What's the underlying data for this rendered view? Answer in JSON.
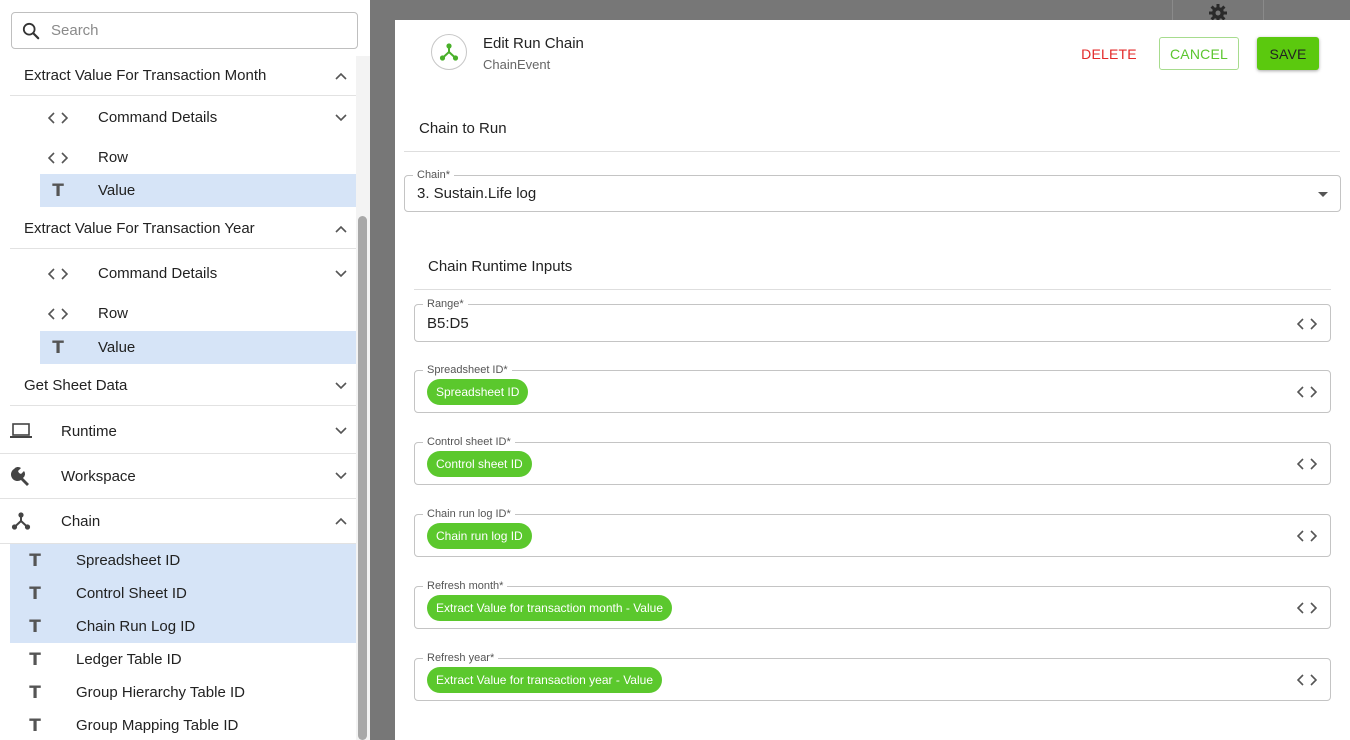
{
  "search": {
    "placeholder": "Search"
  },
  "sidebar": {
    "groups": [
      {
        "title": "Extract Value For Transaction Month",
        "items": [
          {
            "label": "Command Details"
          },
          {
            "label": "Row"
          },
          {
            "label": "Value"
          }
        ]
      },
      {
        "title": "Extract Value For Transaction Year",
        "items": [
          {
            "label": "Command Details"
          },
          {
            "label": "Row"
          },
          {
            "label": "Value"
          }
        ]
      },
      {
        "title": "Get Sheet Data",
        "items": []
      }
    ],
    "categories": [
      {
        "label": "Runtime",
        "icon": "laptop-icon"
      },
      {
        "label": "Workspace",
        "icon": "wrench-icon"
      },
      {
        "label": "Chain",
        "icon": "chain-icon"
      }
    ],
    "chain_items": [
      {
        "label": "Spreadsheet ID"
      },
      {
        "label": "Control Sheet ID"
      },
      {
        "label": "Chain Run Log ID"
      },
      {
        "label": "Ledger Table ID"
      },
      {
        "label": "Group Hierarchy Table ID"
      },
      {
        "label": "Group Mapping Table ID"
      }
    ]
  },
  "dialog": {
    "title": "Edit Run Chain",
    "subtitle": "ChainEvent",
    "delete_label": "DELETE",
    "cancel_label": "CANCEL",
    "save_label": "SAVE",
    "chain_section": "Chain to Run",
    "chain_field": {
      "label": "Chain*",
      "value": "3. Sustain.Life log"
    },
    "inputs_section": "Chain Runtime Inputs",
    "range_field": {
      "label": "Range*",
      "value": "B5:D5"
    },
    "fields": [
      {
        "label": "Spreadsheet ID*",
        "chip": "Spreadsheet ID"
      },
      {
        "label": "Control sheet ID*",
        "chip": "Control sheet ID"
      },
      {
        "label": "Chain run log ID*",
        "chip": "Chain run log ID"
      },
      {
        "label": "Refresh month*",
        "chip": "Extract Value for transaction month - Value"
      },
      {
        "label": "Refresh year*",
        "chip": "Extract Value for transaction year - Value"
      }
    ]
  },
  "colors": {
    "accent_green": "#5bc90e",
    "delete_red": "#e32929",
    "selected_bg": "#d6e4f7"
  }
}
